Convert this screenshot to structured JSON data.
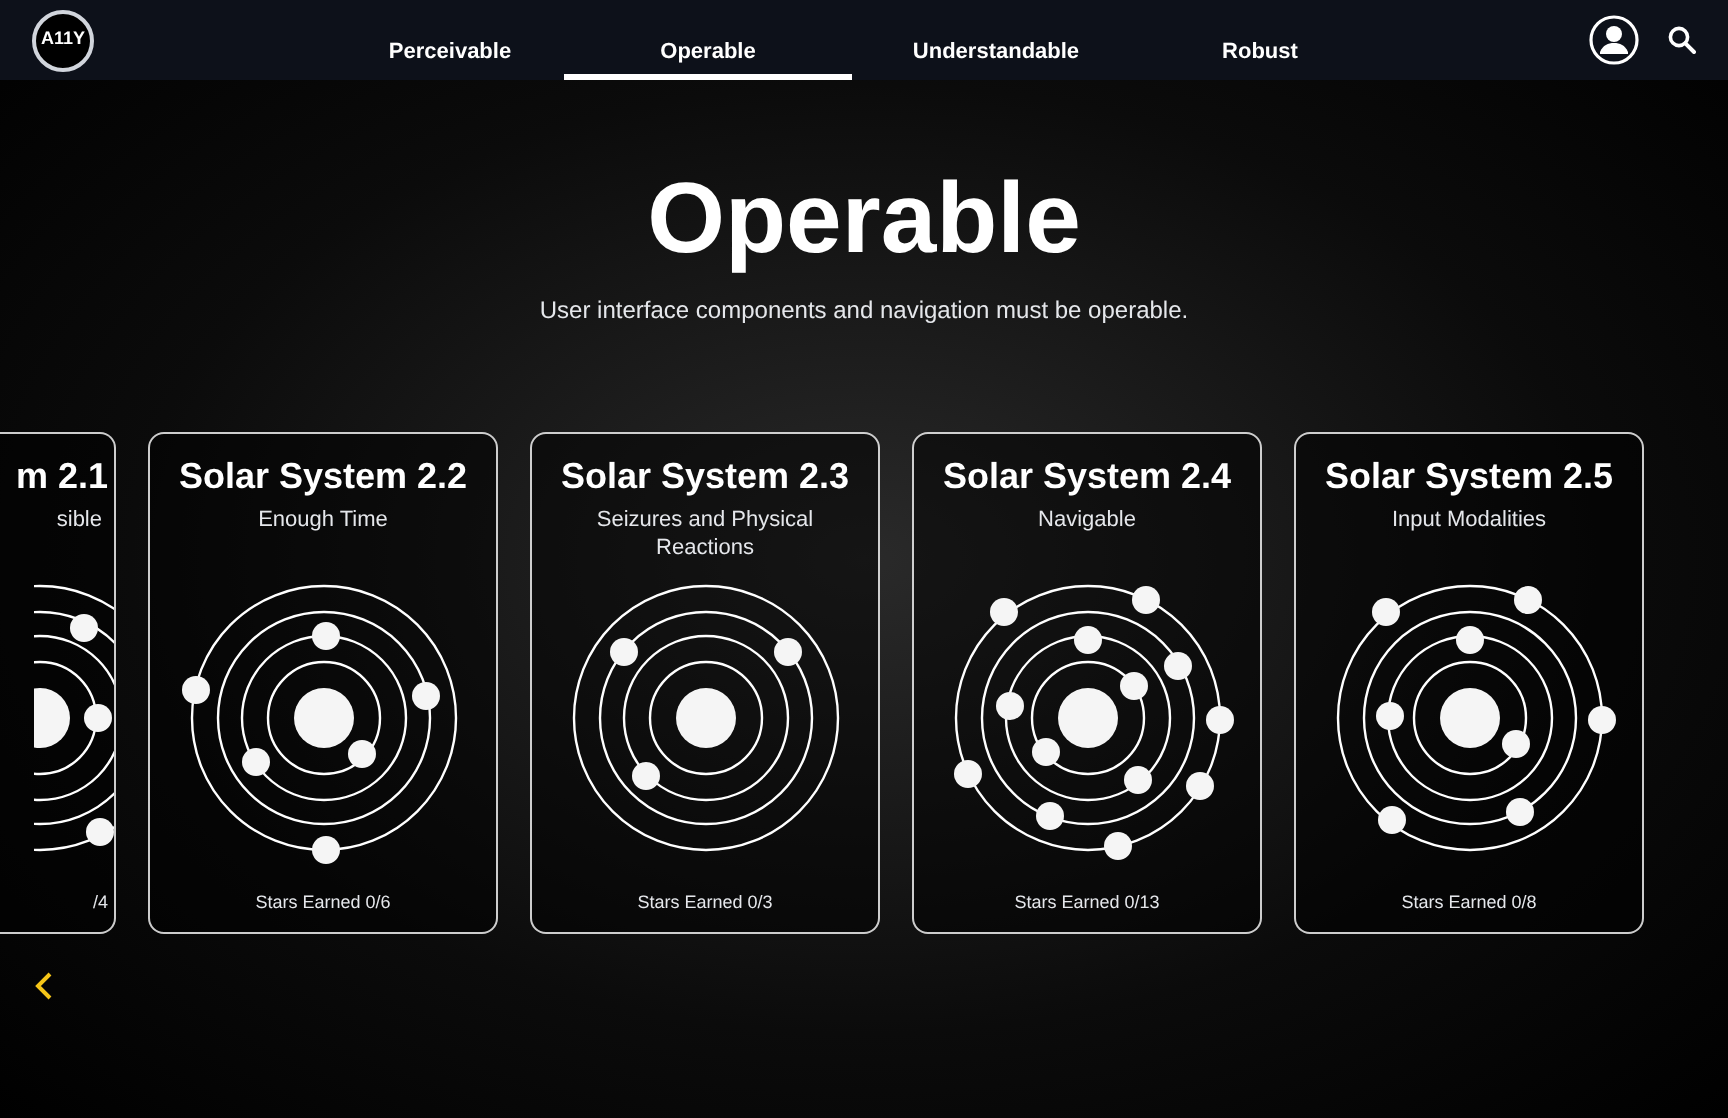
{
  "logo": {
    "text": "A11Y"
  },
  "tabs": [
    {
      "label": "Perceivable",
      "selected": false
    },
    {
      "label": "Operable",
      "selected": true
    },
    {
      "label": "Understandable",
      "selected": false
    },
    {
      "label": "Robust",
      "selected": false
    }
  ],
  "hero": {
    "title": "Operable",
    "subtitle": "User interface components and navigation must be operable."
  },
  "cards": [
    {
      "title": "m 2.1",
      "subtitle": "sible",
      "stars": "/4",
      "cut": true
    },
    {
      "title": "Solar System 2.2",
      "subtitle": "Enough Time",
      "stars": "Stars Earned 0/6",
      "cut": false
    },
    {
      "title": "Solar System 2.3",
      "subtitle": "Seizures and Physical Reactions",
      "stars": "Stars Earned 0/3",
      "cut": false
    },
    {
      "title": "Solar System 2.4",
      "subtitle": "Navigable",
      "stars": "Stars Earned 0/13",
      "cut": false
    },
    {
      "title": "Solar System 2.5",
      "subtitle": "Input Modalities",
      "stars": "Stars Earned 0/8",
      "cut": false
    }
  ]
}
